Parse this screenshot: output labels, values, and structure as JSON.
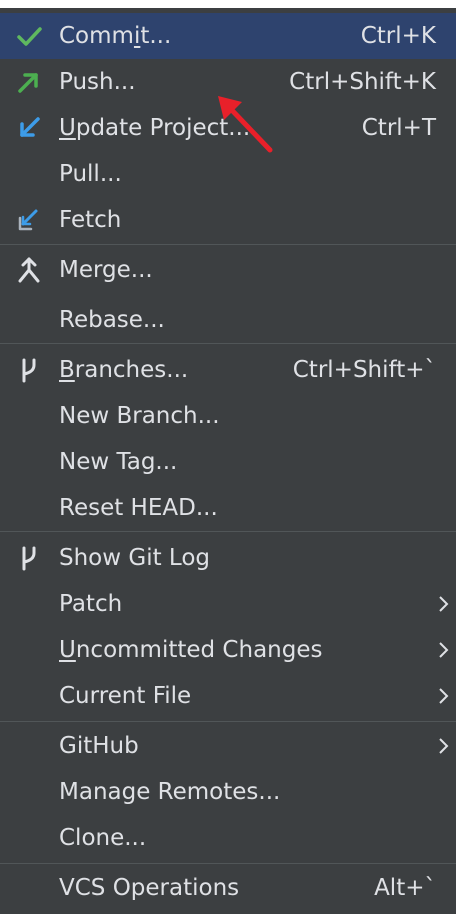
{
  "menu": {
    "items": [
      {
        "name": "commit",
        "icon": "checkmark-icon",
        "pre": "Comm",
        "u": "i",
        "post": "t...",
        "shortcut": "Ctrl+K"
      },
      {
        "name": "push",
        "icon": "arrow-up-right-icon",
        "pre": "",
        "u": "",
        "post": "Push...",
        "shortcut": "Ctrl+Shift+K"
      },
      {
        "name": "update-project",
        "icon": "arrow-down-left-icon",
        "pre": "",
        "u": "U",
        "post": "pdate Project...",
        "shortcut": "Ctrl+T"
      },
      {
        "name": "pull",
        "icon": "",
        "pre": "",
        "u": "",
        "post": "Pull...",
        "shortcut": ""
      },
      {
        "name": "fetch",
        "icon": "fetch-icon",
        "pre": "",
        "u": "",
        "post": "Fetch",
        "shortcut": ""
      },
      {
        "name": "merge",
        "icon": "merge-icon",
        "pre": "",
        "u": "",
        "post": "Merge...",
        "shortcut": ""
      },
      {
        "name": "rebase",
        "icon": "",
        "pre": "",
        "u": "",
        "post": "Rebase...",
        "shortcut": ""
      },
      {
        "name": "branches",
        "icon": "branch-icon",
        "pre": "",
        "u": "B",
        "post": "ranches...",
        "shortcut": "Ctrl+Shift+`"
      },
      {
        "name": "new-branch",
        "icon": "",
        "pre": "",
        "u": "",
        "post": "New Branch...",
        "shortcut": ""
      },
      {
        "name": "new-tag",
        "icon": "",
        "pre": "",
        "u": "",
        "post": "New Tag...",
        "shortcut": ""
      },
      {
        "name": "reset-head",
        "icon": "",
        "pre": "",
        "u": "",
        "post": "Reset HEAD...",
        "shortcut": ""
      },
      {
        "name": "show-git-log",
        "icon": "branch-icon",
        "pre": "",
        "u": "",
        "post": "Show Git Log",
        "shortcut": ""
      },
      {
        "name": "patch",
        "icon": "",
        "pre": "",
        "u": "",
        "post": "Patch",
        "shortcut": "",
        "submenu": true
      },
      {
        "name": "uncommitted-changes",
        "icon": "",
        "pre": "",
        "u": "U",
        "post": "ncommitted Changes",
        "shortcut": "",
        "submenu": true
      },
      {
        "name": "current-file",
        "icon": "",
        "pre": "",
        "u": "",
        "post": "Current File",
        "shortcut": "",
        "submenu": true
      },
      {
        "name": "github",
        "icon": "",
        "pre": "",
        "u": "",
        "post": "GitHub",
        "shortcut": "",
        "submenu": true
      },
      {
        "name": "manage-remotes",
        "icon": "",
        "pre": "",
        "u": "",
        "post": "Manage Remotes...",
        "shortcut": ""
      },
      {
        "name": "clone",
        "icon": "",
        "pre": "",
        "u": "",
        "post": "Clone...",
        "shortcut": ""
      },
      {
        "name": "vcs-operations",
        "icon": "",
        "pre": "",
        "u": "",
        "post": "VCS Operations",
        "shortcut": "Alt+`"
      }
    ],
    "selected": "commit"
  },
  "colors": {
    "background": "#3c3f41",
    "selected": "#2e436e",
    "text": "#dfe1e5",
    "separator": "#515658",
    "check_green": "#5fb85f",
    "push_green": "#4caf50",
    "update_blue": "#3d9ce8",
    "annotation_red": "#e8202a"
  }
}
